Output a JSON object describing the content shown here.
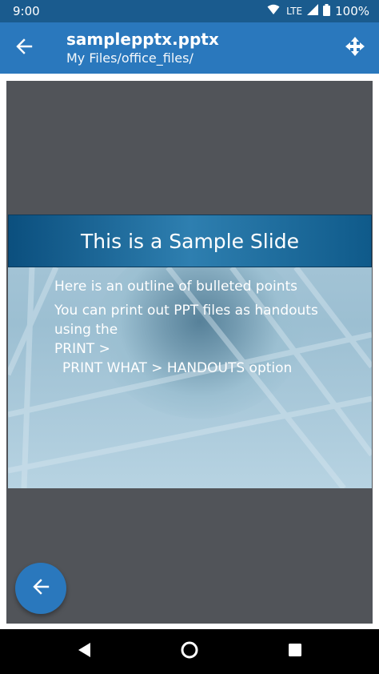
{
  "status_bar": {
    "time": "9:00",
    "network": "LTE",
    "battery": "100%"
  },
  "app_bar": {
    "title": "samplepptx.pptx",
    "subtitle": "My Files/office_files/",
    "back_icon": "arrow-left-icon",
    "move_icon": "move-arrows-icon"
  },
  "slide": {
    "title": "This is a Sample Slide",
    "bullets": [
      [
        "Here is an outline of bulleted points"
      ],
      [
        "You can print out PPT files as handouts",
        "using the",
        "PRINT >",
        "  PRINT WHAT > HANDOUTS option"
      ]
    ]
  },
  "fab": {
    "icon": "arrow-left-icon"
  },
  "nav_bar": {
    "back_icon": "triangle-back-icon",
    "home_icon": "circle-home-icon",
    "recents_icon": "square-recents-icon"
  },
  "colors": {
    "status_bar": "#1a5b8e",
    "app_bar": "#2a78bd",
    "viewer_bg": "#515459",
    "accent": "#2a78bd"
  }
}
